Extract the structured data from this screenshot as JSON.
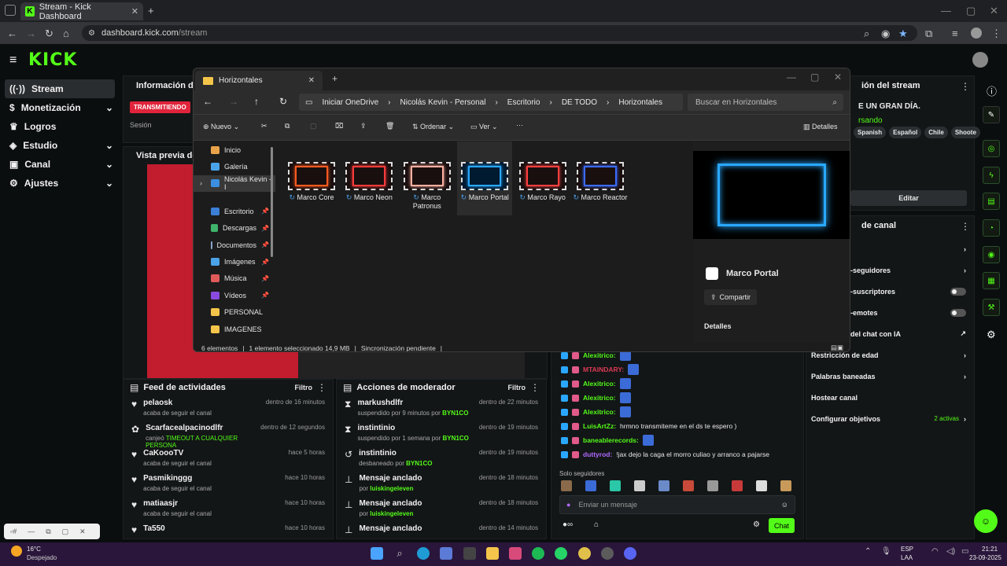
{
  "browser": {
    "tab_title": "Stream - Kick Dashboard",
    "url": "dashboard.kick.com/stream",
    "url_host": "dashboard.kick.com",
    "url_path": "/stream"
  },
  "kick": {
    "logo": "KICK"
  },
  "sidebar": {
    "items": [
      {
        "label": "Stream",
        "active": true
      },
      {
        "label": "Monetización",
        "expand": true
      },
      {
        "label": "Logros"
      },
      {
        "label": "Estudio",
        "expand": true
      },
      {
        "label": "Canal",
        "expand": true
      },
      {
        "label": "Ajustes",
        "expand": true
      }
    ]
  },
  "info_panel": {
    "title": "Información de la",
    "badge": "TRANSMITIENDO",
    "session": "Sesión"
  },
  "preview_panel": {
    "title": "Vista previa del st"
  },
  "activity_feed": {
    "title": "Feed de actividades",
    "filter": "Filtro",
    "items": [
      {
        "name": "pelaosk",
        "sub": "acaba de seguir el canal",
        "time": "dentro de 16 minutos",
        "icon": "heart-icon"
      },
      {
        "name": "Scarfacealpacinodlfr",
        "sub": "canjeó",
        "sub_highlight": "TIMEOUT A CUALQUIER PERSONA",
        "time": "dentro de 12 segundos",
        "icon": "gift-icon"
      },
      {
        "name": "CaKoooTV",
        "sub": "acaba de seguir el canal",
        "time": "hace 5 horas",
        "icon": "heart-icon"
      },
      {
        "name": "Pasmikinggg",
        "sub": "acaba de seguir el canal",
        "time": "hace 10 horas",
        "icon": "heart-icon"
      },
      {
        "name": "matiaasjr",
        "sub": "acaba de seguir el canal",
        "time": "hace 10 horas",
        "icon": "heart-icon"
      },
      {
        "name": "Ta550",
        "sub": "",
        "time": "hace 10 horas",
        "icon": "heart-icon"
      }
    ]
  },
  "mod_actions": {
    "title": "Acciones de moderador",
    "filter": "Filtro",
    "items": [
      {
        "name": "markushdlfr",
        "sub": "suspendido por 9 minutos por",
        "by": "BYN1CO",
        "time": "dentro de 22 minutos",
        "icon": "hourglass-icon"
      },
      {
        "name": "instintinio",
        "sub": "suspendido por 1 semana por",
        "by": "BYN1CO",
        "time": "dentro de 19 minutos",
        "icon": "hourglass-icon"
      },
      {
        "name": "instintinio",
        "sub": "desbaneado por",
        "by": "BYN1CO",
        "time": "dentro de 19 minutos",
        "icon": "undo-icon"
      },
      {
        "name": "Mensaje anclado",
        "sub": "por",
        "by": "luiskingeleven",
        "time": "dentro de 18 minutos",
        "icon": "pin-icon"
      },
      {
        "name": "Mensaje anclado",
        "sub": "por",
        "by": "luiskingeleven",
        "time": "dentro de 18 minutos",
        "icon": "pin-icon"
      },
      {
        "name": "Mensaje anclado",
        "sub": "",
        "by": "",
        "time": "dentro de 14 minutos",
        "icon": "pin-icon"
      }
    ]
  },
  "chat": {
    "lines": [
      {
        "user": "Alexitrico:",
        "color": "#53fc18",
        "text": ""
      },
      {
        "user": "MTAINDARY:",
        "color": "#d83a55",
        "text": ""
      },
      {
        "user": "Alexitrico:",
        "color": "#53fc18",
        "text": ""
      },
      {
        "user": "Alexitrico:",
        "color": "#53fc18",
        "text": ""
      },
      {
        "user": "Alexitrico:",
        "color": "#53fc18",
        "text": ""
      },
      {
        "user": "LuisArtZz:",
        "color": "#53fc18",
        "text": "hrmno transmiteme en el ds te espero )"
      },
      {
        "user": "baneablerecords:",
        "color": "#53fc18",
        "text": ""
      },
      {
        "user": "duttyrod:",
        "color": "#b069ff",
        "text": "!jax dejo la caga el morro culiao y arranco a pajarse"
      }
    ],
    "followers_only": "Solo seguidores",
    "placeholder": "Enviar un mensaje",
    "send": "Chat"
  },
  "stream_info": {
    "title": "ión del stream",
    "stream_title": "E UN GRAN DÍA.",
    "category": "rsando",
    "tags": [
      "Spanish",
      "Español",
      "Chile",
      "Shoote"
    ],
    "edit": "Editar"
  },
  "channel_settings": {
    "title": "de canal",
    "rows": [
      {
        "label": "",
        "kind": "chevron"
      },
      {
        "label": "-seguidores",
        "kind": "chevron"
      },
      {
        "label": "-suscriptores",
        "kind": "toggle"
      },
      {
        "label": "-emotes",
        "kind": "toggle"
      },
      {
        "label": "del chat con IA",
        "kind": "link"
      },
      {
        "label": "Restricción de edad",
        "kind": "chevron"
      },
      {
        "label": "Palabras baneadas",
        "kind": "chevron"
      },
      {
        "label": "Hostear canal",
        "kind": "none"
      },
      {
        "label": "Configurar objetivos",
        "kind": "chevron",
        "extra": "2 activas"
      }
    ]
  },
  "explorer": {
    "tab": "Horizontales",
    "breadcrumb": [
      "Iniciar OneDrive",
      "Nicolás Kevin - Personal",
      "Escritorio",
      "DE TODO",
      "Horizontales"
    ],
    "search": "Buscar en Horizontales",
    "toolbar": {
      "new": "Nuevo",
      "sort": "Ordenar",
      "view": "Ver",
      "details": "Detalles"
    },
    "nav": [
      {
        "label": "Inicio",
        "color": "#e8a24a"
      },
      {
        "label": "Galería",
        "color": "#4aa3e8"
      },
      {
        "label": "Nicolás Kevin - I",
        "color": "#3b8ee0",
        "active": true
      },
      {
        "label": "Escritorio",
        "color": "#3b7fd6",
        "pin": true
      },
      {
        "label": "Descargas",
        "color": "#3fb46a",
        "pin": true
      },
      {
        "label": "Documentos",
        "color": "#8aa4c8",
        "pin": true
      },
      {
        "label": "Imágenes",
        "color": "#4aa3e8",
        "pin": true
      },
      {
        "label": "Música",
        "color": "#e05a5a",
        "pin": true
      },
      {
        "label": "Vídeos",
        "color": "#8a4ae0",
        "pin": true
      },
      {
        "label": "PERSONAL",
        "color": "#f4c54a"
      },
      {
        "label": "IMAGENES",
        "color": "#f4c54a"
      }
    ],
    "files": [
      {
        "name": "Marco Core",
        "color": "#ff5a1f"
      },
      {
        "name": "Marco Neon",
        "color": "#ff3b3b"
      },
      {
        "name": "Marco Patronus",
        "color": "#ffb0a0"
      },
      {
        "name": "Marco Portal",
        "color": "#2aa8ff",
        "selected": true
      },
      {
        "name": "Marco Rayo",
        "color": "#ff4040"
      },
      {
        "name": "Marco Reactor",
        "color": "#3b6bff"
      }
    ],
    "preview": {
      "name": "Marco Portal",
      "share": "Compartir",
      "details": "Detalles"
    },
    "status": [
      "6 elementos",
      "1 elemento seleccionado 14,9 MB",
      "Sincronización pendiente"
    ]
  },
  "taskbar": {
    "temp": "16°C",
    "weather": "Despejado",
    "lang": "ESP",
    "lang2": "LAA",
    "time": "21:21",
    "date": "23-09-2025"
  }
}
